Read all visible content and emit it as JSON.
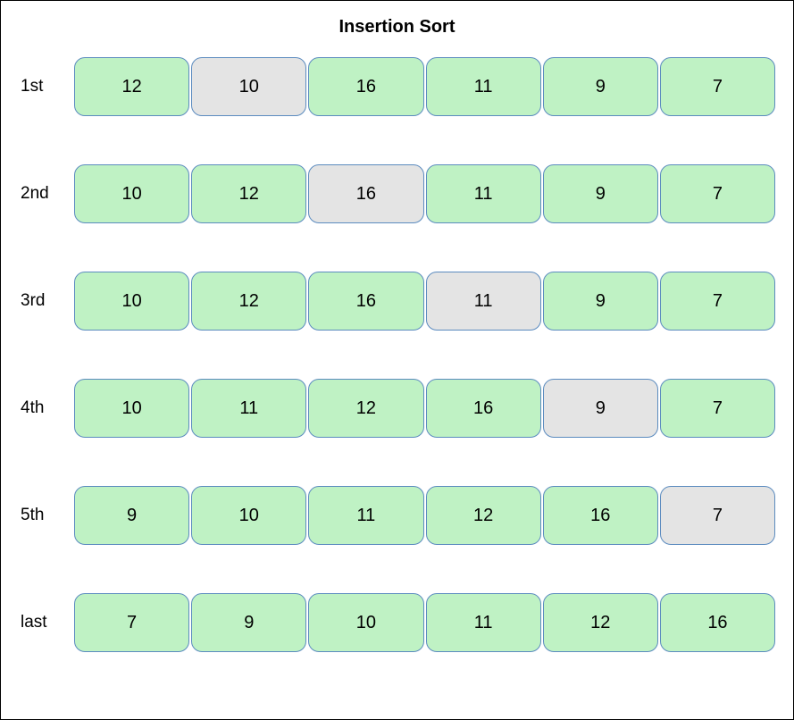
{
  "title": "Insertion Sort",
  "colors": {
    "normal": "#bff2c4",
    "highlight": "#e4e4e4",
    "border": "#5b8bbf"
  },
  "rows": [
    {
      "label": "1st",
      "values": [
        12,
        10,
        16,
        11,
        9,
        7
      ],
      "highlight_index": 1
    },
    {
      "label": "2nd",
      "values": [
        10,
        12,
        16,
        11,
        9,
        7
      ],
      "highlight_index": 2
    },
    {
      "label": "3rd",
      "values": [
        10,
        12,
        16,
        11,
        9,
        7
      ],
      "highlight_index": 3
    },
    {
      "label": "4th",
      "values": [
        10,
        11,
        12,
        16,
        9,
        7
      ],
      "highlight_index": 4
    },
    {
      "label": "5th",
      "values": [
        9,
        10,
        11,
        12,
        16,
        7
      ],
      "highlight_index": 5
    },
    {
      "label": "last",
      "values": [
        7,
        9,
        10,
        11,
        12,
        16
      ],
      "highlight_index": null
    }
  ]
}
